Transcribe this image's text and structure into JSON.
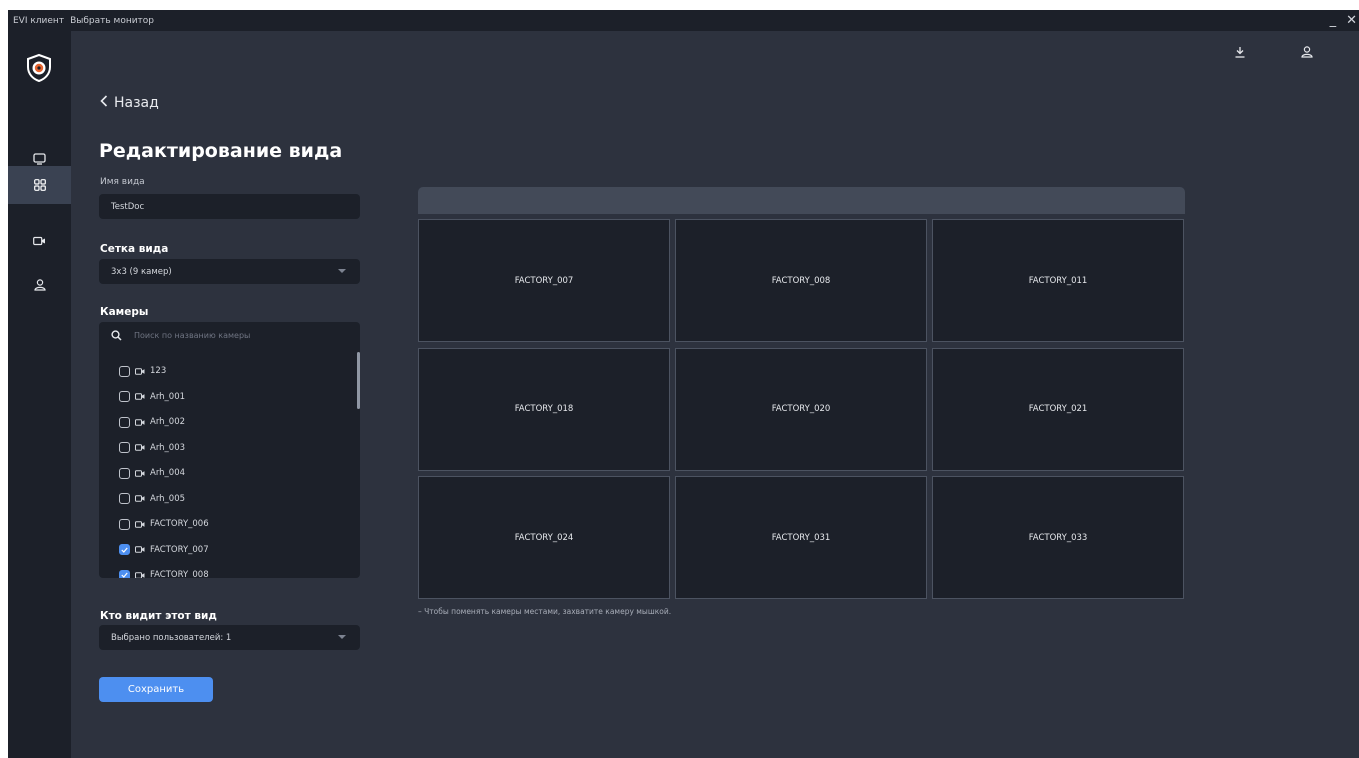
{
  "titlebar": {
    "app_name": "EVI клиент",
    "menu_monitor": "Выбрать монитор",
    "minimize": "_",
    "close": "✕"
  },
  "rail": {
    "items": [
      {
        "icon": "monitor-icon",
        "active": false
      },
      {
        "icon": "grid-view-icon",
        "active": true
      },
      {
        "icon": "camera-icon",
        "active": false
      },
      {
        "icon": "user-icon",
        "active": false
      }
    ]
  },
  "header_icons": [
    "download-icon",
    "user-icon"
  ],
  "back_label": "Назад",
  "page_title": "Редактирование вида",
  "view_name": {
    "label": "Имя вида",
    "value": "TestDoc"
  },
  "grid_select": {
    "label": "Сетка вида",
    "value": "3x3 (9 камер)"
  },
  "cameras": {
    "label": "Камеры",
    "search_placeholder": "Поиск по названию камеры",
    "items": [
      {
        "name": "123",
        "checked": false
      },
      {
        "name": "Arh_001",
        "checked": false
      },
      {
        "name": "Arh_002",
        "checked": false
      },
      {
        "name": "Arh_003",
        "checked": false
      },
      {
        "name": "Arh_004",
        "checked": false
      },
      {
        "name": "Arh_005",
        "checked": false
      },
      {
        "name": "FACTORY_006",
        "checked": false
      },
      {
        "name": "FACTORY_007",
        "checked": true
      },
      {
        "name": "FACTORY_008",
        "checked": true
      }
    ]
  },
  "visibility": {
    "label": "Кто видит этот вид",
    "value": "Выбрано пользователей: 1"
  },
  "save_label": "Сохранить",
  "grid_cells": [
    "FACTORY_007",
    "FACTORY_008",
    "FACTORY_011",
    "FACTORY_018",
    "FACTORY_020",
    "FACTORY_021",
    "FACTORY_024",
    "FACTORY_031",
    "FACTORY_033"
  ],
  "hint": "– Чтобы поменять камеры местами, захватите камеру мышкой.",
  "colors": {
    "accent": "#4d8ff0",
    "background": "#2d323e",
    "panel": "#1c2029"
  }
}
